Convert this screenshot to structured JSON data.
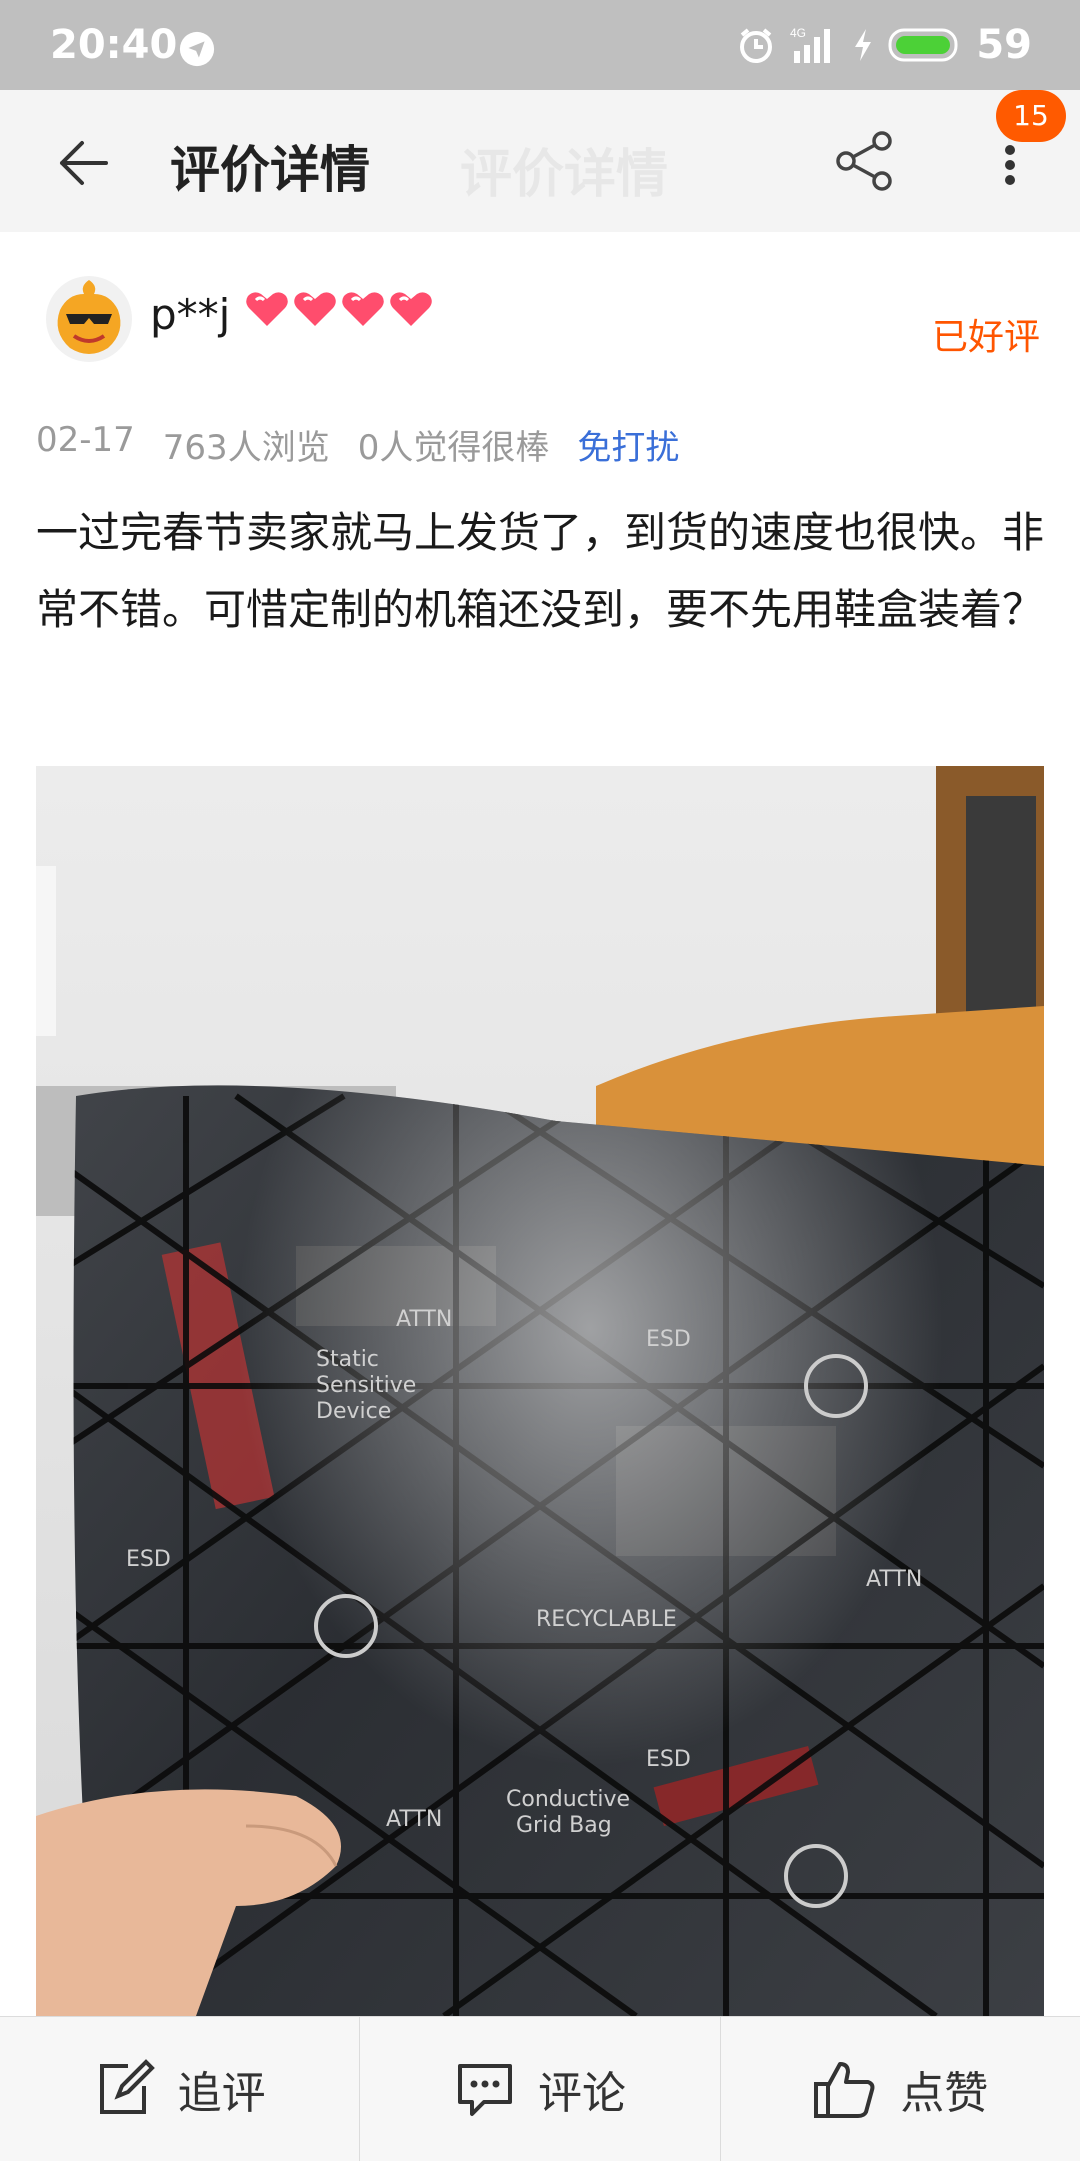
{
  "status_bar": {
    "time": "20:40",
    "battery": "59",
    "icons": [
      "location-icon",
      "alarm-icon",
      "signal-4g-icon",
      "charging-icon",
      "battery-icon"
    ]
  },
  "app_bar": {
    "title": "评价详情",
    "notification_count": "15",
    "icons": [
      "back-arrow-icon",
      "share-icon",
      "more-vertical-icon"
    ]
  },
  "review": {
    "username": "p**j",
    "level_hearts": 4,
    "status": "已好评",
    "date": "02-17",
    "views": "763人浏览",
    "likes": "0人觉得很棒",
    "no_disturb": "免打扰",
    "text": "一过完春节卖家就马上发货了，到货的速度也很快。非常不错。可惜定制的机箱还没到，要不先用鞋盒装着？"
  },
  "photo": {
    "bag_labels": [
      "ESD",
      "ATTN",
      "Static Sensitive Device",
      "Conductive Grid Bag",
      "RECYCLABLE"
    ]
  },
  "bottom_bar": {
    "follow_up": "追评",
    "comment": "评论",
    "like": "点赞"
  },
  "colors": {
    "accent": "#ff5500",
    "badge": "#ff5a00",
    "link": "#3a6fd8",
    "status_bar": "#bfbfbf"
  }
}
